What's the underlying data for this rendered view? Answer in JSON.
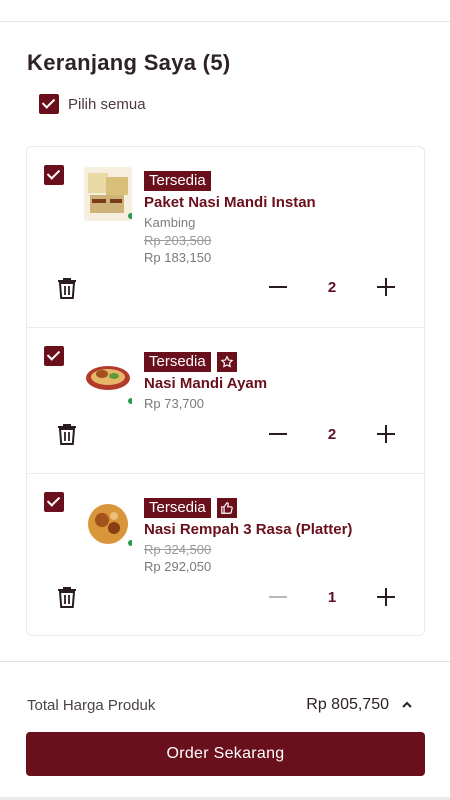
{
  "page": {
    "title": "Keranjang Saya (5)"
  },
  "select_all": {
    "label": "Pilih semua",
    "checked": true
  },
  "items": [
    {
      "checked": true,
      "badge": "Tersedia",
      "extra_badge_icon": "",
      "name": "Paket Nasi Mandi Instan",
      "variant": "Kambing",
      "old_price": "Rp 203,500",
      "price": "Rp 183,150",
      "quantity": "2",
      "minus_disabled": false
    },
    {
      "checked": true,
      "badge": "Tersedia",
      "extra_badge_icon": "star-icon",
      "name": "Nasi Mandi Ayam",
      "variant": "",
      "old_price": "",
      "price": "Rp 73,700",
      "quantity": "2",
      "minus_disabled": false
    },
    {
      "checked": true,
      "badge": "Tersedia",
      "extra_badge_icon": "thumbs-up-icon",
      "name": "Nasi Rempah 3 Rasa (Platter)",
      "variant": "",
      "old_price": "Rp 324,500",
      "price": "Rp 292,050",
      "quantity": "1",
      "minus_disabled": true
    }
  ],
  "footer": {
    "total_label": "Total Harga Produk",
    "total_value": "Rp 805,750",
    "order_button": "Order Sekarang"
  },
  "colors": {
    "brand": "#6a0f1c",
    "muted": "#7a7a7a",
    "available_dot": "#2c9a4f"
  }
}
